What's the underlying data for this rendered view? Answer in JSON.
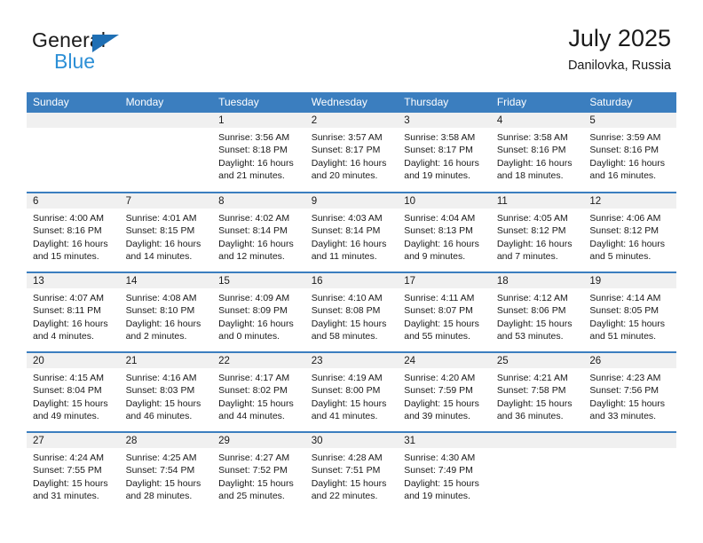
{
  "brand": {
    "name_top": "General",
    "name_bottom": "Blue",
    "triangle_color": "#1f6fb4",
    "blue_text_color": "#2c8fd6"
  },
  "header": {
    "title": "July 2025",
    "location": "Danilovka, Russia"
  },
  "theme": {
    "header_row_bg": "#3b7ebf",
    "daynum_band_bg": "#f0f0f0",
    "row_divider": "#3b7ebf",
    "text": "#1a1a1a"
  },
  "weekday_headers": [
    "Sunday",
    "Monday",
    "Tuesday",
    "Wednesday",
    "Thursday",
    "Friday",
    "Saturday"
  ],
  "weeks": [
    [
      {
        "day": "",
        "empty": true
      },
      {
        "day": "",
        "empty": true
      },
      {
        "day": "1",
        "sunrise": "Sunrise: 3:56 AM",
        "sunset": "Sunset: 8:18 PM",
        "daylight_1": "Daylight: 16 hours",
        "daylight_2": "and 21 minutes."
      },
      {
        "day": "2",
        "sunrise": "Sunrise: 3:57 AM",
        "sunset": "Sunset: 8:17 PM",
        "daylight_1": "Daylight: 16 hours",
        "daylight_2": "and 20 minutes."
      },
      {
        "day": "3",
        "sunrise": "Sunrise: 3:58 AM",
        "sunset": "Sunset: 8:17 PM",
        "daylight_1": "Daylight: 16 hours",
        "daylight_2": "and 19 minutes."
      },
      {
        "day": "4",
        "sunrise": "Sunrise: 3:58 AM",
        "sunset": "Sunset: 8:16 PM",
        "daylight_1": "Daylight: 16 hours",
        "daylight_2": "and 18 minutes."
      },
      {
        "day": "5",
        "sunrise": "Sunrise: 3:59 AM",
        "sunset": "Sunset: 8:16 PM",
        "daylight_1": "Daylight: 16 hours",
        "daylight_2": "and 16 minutes."
      }
    ],
    [
      {
        "day": "6",
        "sunrise": "Sunrise: 4:00 AM",
        "sunset": "Sunset: 8:16 PM",
        "daylight_1": "Daylight: 16 hours",
        "daylight_2": "and 15 minutes."
      },
      {
        "day": "7",
        "sunrise": "Sunrise: 4:01 AM",
        "sunset": "Sunset: 8:15 PM",
        "daylight_1": "Daylight: 16 hours",
        "daylight_2": "and 14 minutes."
      },
      {
        "day": "8",
        "sunrise": "Sunrise: 4:02 AM",
        "sunset": "Sunset: 8:14 PM",
        "daylight_1": "Daylight: 16 hours",
        "daylight_2": "and 12 minutes."
      },
      {
        "day": "9",
        "sunrise": "Sunrise: 4:03 AM",
        "sunset": "Sunset: 8:14 PM",
        "daylight_1": "Daylight: 16 hours",
        "daylight_2": "and 11 minutes."
      },
      {
        "day": "10",
        "sunrise": "Sunrise: 4:04 AM",
        "sunset": "Sunset: 8:13 PM",
        "daylight_1": "Daylight: 16 hours",
        "daylight_2": "and 9 minutes."
      },
      {
        "day": "11",
        "sunrise": "Sunrise: 4:05 AM",
        "sunset": "Sunset: 8:12 PM",
        "daylight_1": "Daylight: 16 hours",
        "daylight_2": "and 7 minutes."
      },
      {
        "day": "12",
        "sunrise": "Sunrise: 4:06 AM",
        "sunset": "Sunset: 8:12 PM",
        "daylight_1": "Daylight: 16 hours",
        "daylight_2": "and 5 minutes."
      }
    ],
    [
      {
        "day": "13",
        "sunrise": "Sunrise: 4:07 AM",
        "sunset": "Sunset: 8:11 PM",
        "daylight_1": "Daylight: 16 hours",
        "daylight_2": "and 4 minutes."
      },
      {
        "day": "14",
        "sunrise": "Sunrise: 4:08 AM",
        "sunset": "Sunset: 8:10 PM",
        "daylight_1": "Daylight: 16 hours",
        "daylight_2": "and 2 minutes."
      },
      {
        "day": "15",
        "sunrise": "Sunrise: 4:09 AM",
        "sunset": "Sunset: 8:09 PM",
        "daylight_1": "Daylight: 16 hours",
        "daylight_2": "and 0 minutes."
      },
      {
        "day": "16",
        "sunrise": "Sunrise: 4:10 AM",
        "sunset": "Sunset: 8:08 PM",
        "daylight_1": "Daylight: 15 hours",
        "daylight_2": "and 58 minutes."
      },
      {
        "day": "17",
        "sunrise": "Sunrise: 4:11 AM",
        "sunset": "Sunset: 8:07 PM",
        "daylight_1": "Daylight: 15 hours",
        "daylight_2": "and 55 minutes."
      },
      {
        "day": "18",
        "sunrise": "Sunrise: 4:12 AM",
        "sunset": "Sunset: 8:06 PM",
        "daylight_1": "Daylight: 15 hours",
        "daylight_2": "and 53 minutes."
      },
      {
        "day": "19",
        "sunrise": "Sunrise: 4:14 AM",
        "sunset": "Sunset: 8:05 PM",
        "daylight_1": "Daylight: 15 hours",
        "daylight_2": "and 51 minutes."
      }
    ],
    [
      {
        "day": "20",
        "sunrise": "Sunrise: 4:15 AM",
        "sunset": "Sunset: 8:04 PM",
        "daylight_1": "Daylight: 15 hours",
        "daylight_2": "and 49 minutes."
      },
      {
        "day": "21",
        "sunrise": "Sunrise: 4:16 AM",
        "sunset": "Sunset: 8:03 PM",
        "daylight_1": "Daylight: 15 hours",
        "daylight_2": "and 46 minutes."
      },
      {
        "day": "22",
        "sunrise": "Sunrise: 4:17 AM",
        "sunset": "Sunset: 8:02 PM",
        "daylight_1": "Daylight: 15 hours",
        "daylight_2": "and 44 minutes."
      },
      {
        "day": "23",
        "sunrise": "Sunrise: 4:19 AM",
        "sunset": "Sunset: 8:00 PM",
        "daylight_1": "Daylight: 15 hours",
        "daylight_2": "and 41 minutes."
      },
      {
        "day": "24",
        "sunrise": "Sunrise: 4:20 AM",
        "sunset": "Sunset: 7:59 PM",
        "daylight_1": "Daylight: 15 hours",
        "daylight_2": "and 39 minutes."
      },
      {
        "day": "25",
        "sunrise": "Sunrise: 4:21 AM",
        "sunset": "Sunset: 7:58 PM",
        "daylight_1": "Daylight: 15 hours",
        "daylight_2": "and 36 minutes."
      },
      {
        "day": "26",
        "sunrise": "Sunrise: 4:23 AM",
        "sunset": "Sunset: 7:56 PM",
        "daylight_1": "Daylight: 15 hours",
        "daylight_2": "and 33 minutes."
      }
    ],
    [
      {
        "day": "27",
        "sunrise": "Sunrise: 4:24 AM",
        "sunset": "Sunset: 7:55 PM",
        "daylight_1": "Daylight: 15 hours",
        "daylight_2": "and 31 minutes."
      },
      {
        "day": "28",
        "sunrise": "Sunrise: 4:25 AM",
        "sunset": "Sunset: 7:54 PM",
        "daylight_1": "Daylight: 15 hours",
        "daylight_2": "and 28 minutes."
      },
      {
        "day": "29",
        "sunrise": "Sunrise: 4:27 AM",
        "sunset": "Sunset: 7:52 PM",
        "daylight_1": "Daylight: 15 hours",
        "daylight_2": "and 25 minutes."
      },
      {
        "day": "30",
        "sunrise": "Sunrise: 4:28 AM",
        "sunset": "Sunset: 7:51 PM",
        "daylight_1": "Daylight: 15 hours",
        "daylight_2": "and 22 minutes."
      },
      {
        "day": "31",
        "sunrise": "Sunrise: 4:30 AM",
        "sunset": "Sunset: 7:49 PM",
        "daylight_1": "Daylight: 15 hours",
        "daylight_2": "and 19 minutes."
      },
      {
        "day": "",
        "empty": true
      },
      {
        "day": "",
        "empty": true
      }
    ]
  ]
}
